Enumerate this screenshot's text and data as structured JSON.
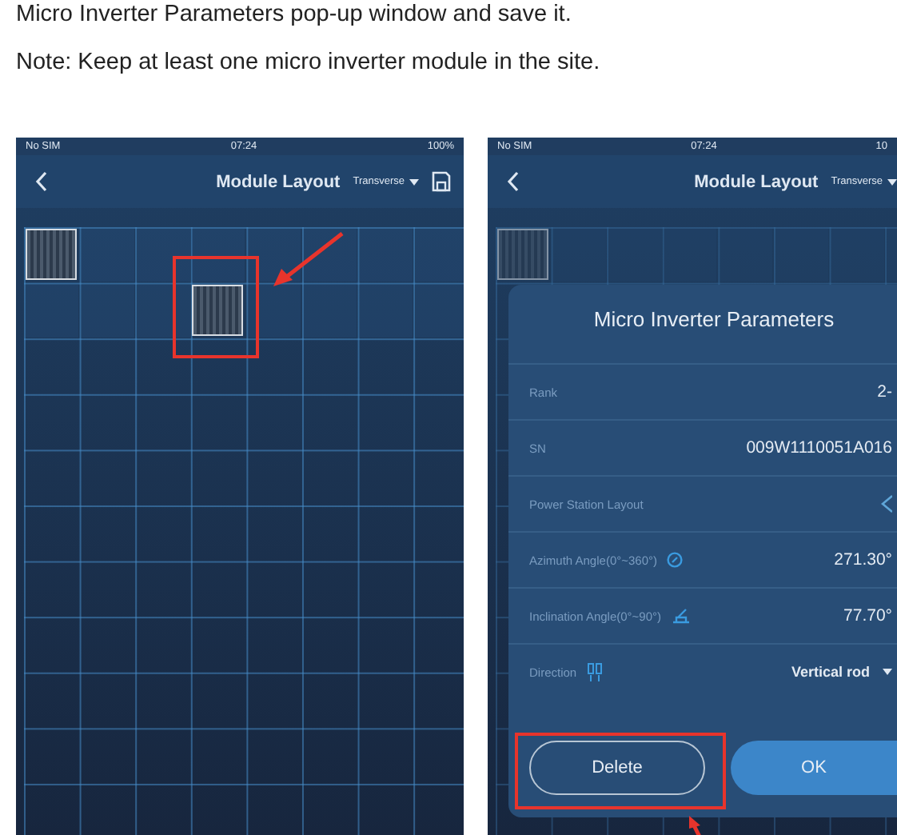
{
  "instructions": {
    "line": "Micro Inverter Parameters pop-up window and save it.",
    "note": "Note: Keep at least one micro inverter module in the site."
  },
  "screens": [
    {
      "status_bar": {
        "carrier": "No SIM",
        "time": "07:24",
        "battery": "100%"
      },
      "nav": {
        "title": "Module Layout",
        "orientation": "Transverse"
      },
      "module_rows": [
        [
          true,
          false,
          false,
          false,
          false,
          false,
          false,
          false
        ],
        [
          false,
          false,
          false,
          true,
          false,
          false,
          false,
          false
        ]
      ],
      "annotation": {
        "kind": "module"
      }
    },
    {
      "status_bar": {
        "carrier": "No SIM",
        "time": "07:24",
        "battery": "10"
      },
      "nav": {
        "title": "Module Layout",
        "orientation": "Transverse"
      },
      "module_rows": [
        [
          true,
          false,
          false,
          false,
          false,
          false,
          false,
          false
        ]
      ],
      "annotation": {
        "kind": "delete"
      },
      "dialog": {
        "title": "Micro Inverter Parameters",
        "fields": [
          {
            "kind": "value",
            "label": "Rank",
            "value": "2-"
          },
          {
            "kind": "value",
            "label": "SN",
            "value": "009W1110051A016"
          },
          {
            "kind": "link",
            "label": "Power Station Layout"
          },
          {
            "kind": "compass",
            "label": "Azimuth Angle(0°~360°)",
            "value": "271.30°"
          },
          {
            "kind": "tilt",
            "label": "Inclination Angle(0°~90°)",
            "value": "77.70°"
          },
          {
            "kind": "select",
            "label": "Direction",
            "value": "Vertical rod"
          }
        ],
        "buttons": [
          {
            "kind": "outline",
            "label": "Delete"
          },
          {
            "kind": "filled",
            "label": "OK"
          }
        ]
      }
    }
  ]
}
